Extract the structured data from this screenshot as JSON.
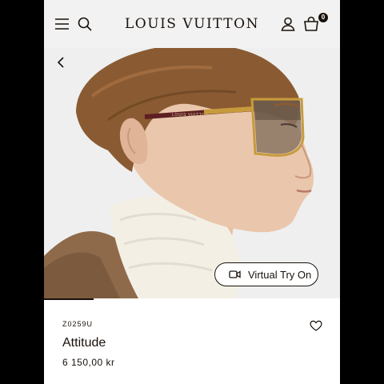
{
  "header": {
    "brand": "LOUIS VUITTON",
    "bag_count": "0",
    "icons": [
      "menu-icon",
      "search-icon",
      "account-icon",
      "bag-icon"
    ]
  },
  "hero": {
    "virtual_try_on_label": "Virtual Try On",
    "temple_text": "LOUIS VUITTON",
    "icons": [
      "back-icon",
      "video-camera-icon"
    ]
  },
  "product": {
    "sku": "Z0259U",
    "name": "Attitude",
    "price": "6 150,00 kr",
    "icons": [
      "heart-icon"
    ]
  },
  "colors": {
    "text": "#19110b",
    "header_bg": "#f2f2f2",
    "hero_bg": "#efefef"
  }
}
